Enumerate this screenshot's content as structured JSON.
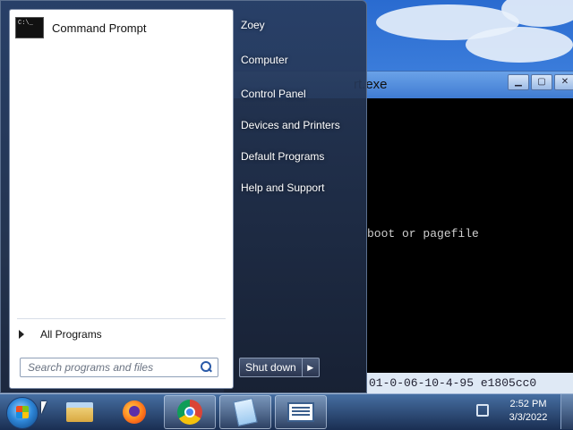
{
  "console_window": {
    "title_fragment": "rt.exe",
    "controls": [
      "▁",
      "▢",
      "✕"
    ],
    "text_line": "boot or pagefile",
    "bottom_text": "01-0-06-10-4-95  e1805cc0"
  },
  "start_menu": {
    "pinned_program": "Command Prompt",
    "all_programs": "All Programs",
    "search_placeholder": "Search programs and files",
    "right_items": [
      "Zoey",
      "Computer",
      "Control Panel",
      "Devices and Printers",
      "Default Programs",
      "Help and Support"
    ],
    "shutdown_label": "Shut down",
    "shutdown_arrow": "▶"
  },
  "taskbar": {
    "apps": [
      "file-explorer-icon",
      "firefox-icon",
      "chrome-icon",
      "notepad-icon",
      "console-app-icon"
    ],
    "clock_time": "2:52 PM",
    "clock_date": "3/3/2022"
  }
}
